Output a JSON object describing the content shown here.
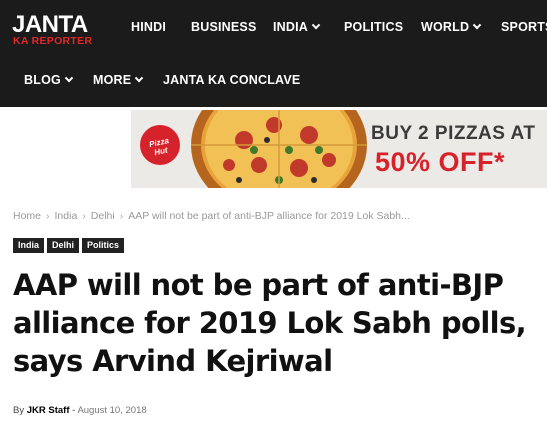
{
  "header": {
    "logo_main": "JANTA",
    "logo_sub": "KA REPORTER",
    "nav": [
      {
        "label": "HINDI"
      },
      {
        "label": "BUSINESS"
      },
      {
        "label": "INDIA"
      },
      {
        "label": "POLITICS"
      },
      {
        "label": "WORLD"
      },
      {
        "label": "SPORTS"
      },
      {
        "label": "BLOG"
      },
      {
        "label": "MORE"
      },
      {
        "label": "JANTA KA CONCLAVE"
      }
    ]
  },
  "ad": {
    "logo_text": "Pizza Hut",
    "line1": "BUY 2 PIZZAS AT",
    "line2": "50% OFF*"
  },
  "breadcrumb": [
    "Home",
    "India",
    "Delhi",
    "AAP will not be part of anti-BJP alliance for 2019 Lok Sabh..."
  ],
  "tags": [
    "India",
    "Delhi",
    "Politics"
  ],
  "article": {
    "title": "AAP will not be part of anti-BJP alliance for 2019 Lok Sabh polls, says Arvind Kejriwal",
    "by": "By",
    "author": "JKR Staff",
    "separator": "-",
    "date": "August 10, 2018"
  },
  "colors": {
    "header_bg": "#1b1b1b",
    "brand_red": "#e0282b",
    "tag_bg": "#222222",
    "ad_red": "#d6222a"
  },
  "icons": {
    "dropdown": "chevron-down-icon"
  }
}
